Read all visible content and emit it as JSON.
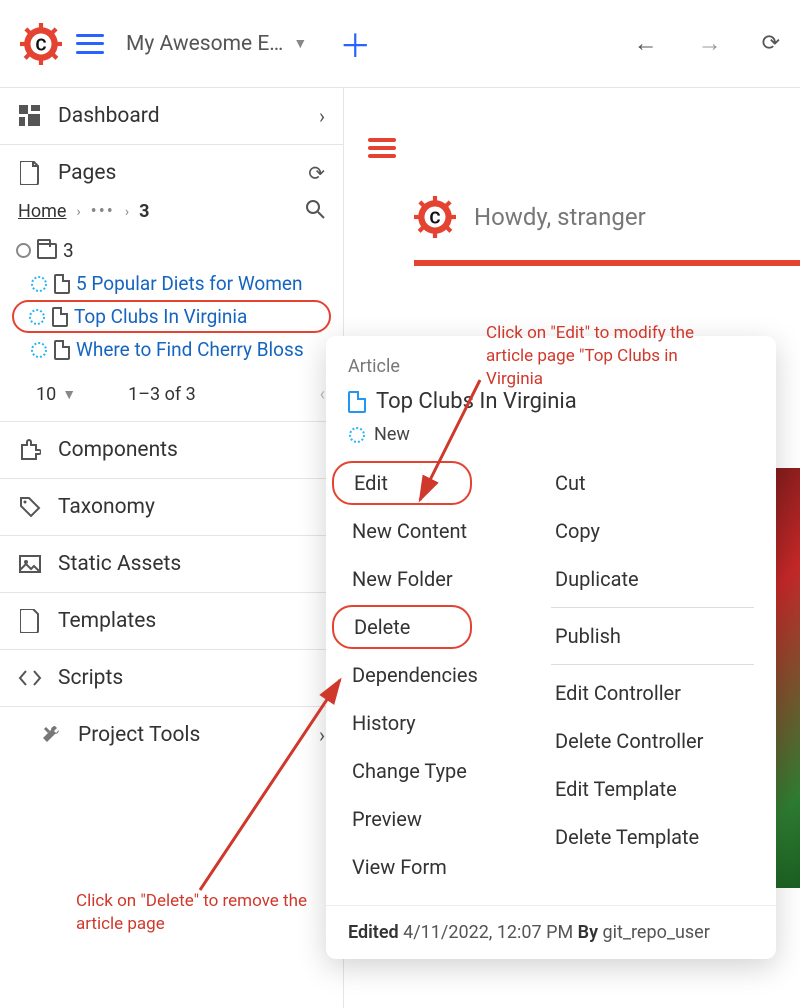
{
  "topbar": {
    "site_name": "My Awesome E…"
  },
  "dashboard": {
    "label": "Dashboard"
  },
  "pages": {
    "label": "Pages",
    "breadcrumb_home": "Home",
    "breadcrumb_more": "•••",
    "breadcrumb_current": "3",
    "tree_root": "3",
    "items": [
      {
        "label": "5 Popular Diets for Women"
      },
      {
        "label": "Top Clubs In Virginia"
      },
      {
        "label": "Where to Find Cherry Bloss"
      }
    ],
    "per_page": "10",
    "range": "1–3 of 3"
  },
  "nav": {
    "components": "Components",
    "taxonomy": "Taxonomy",
    "static_assets": "Static Assets",
    "templates": "Templates",
    "scripts": "Scripts",
    "project_tools": "Project Tools"
  },
  "content": {
    "greeting": "Howdy, stranger"
  },
  "context_menu": {
    "heading": "Article",
    "title": "Top Clubs In Virginia",
    "status": "New",
    "left": [
      "Edit",
      "New Content",
      "New Folder",
      "Delete",
      "Dependencies",
      "History",
      "Change Type",
      "Preview",
      "View Form"
    ],
    "right": [
      "Cut",
      "Copy",
      "Duplicate",
      "Publish",
      "Edit Controller",
      "Delete Controller",
      "Edit Template",
      "Delete Template"
    ],
    "footer_edited_label": "Edited",
    "footer_date": "4/11/2022, 12:07 PM",
    "footer_by_label": "By",
    "footer_user": "git_repo_user"
  },
  "annotations": {
    "edit": "Click on \"Edit\" to modify the article page \"Top Clubs in Virginia",
    "delete": "Click on \"Delete\" to remove the article page"
  },
  "colors": {
    "accent_red": "#e44332",
    "link_blue": "#1565c0",
    "primary_blue": "#2962ff"
  }
}
